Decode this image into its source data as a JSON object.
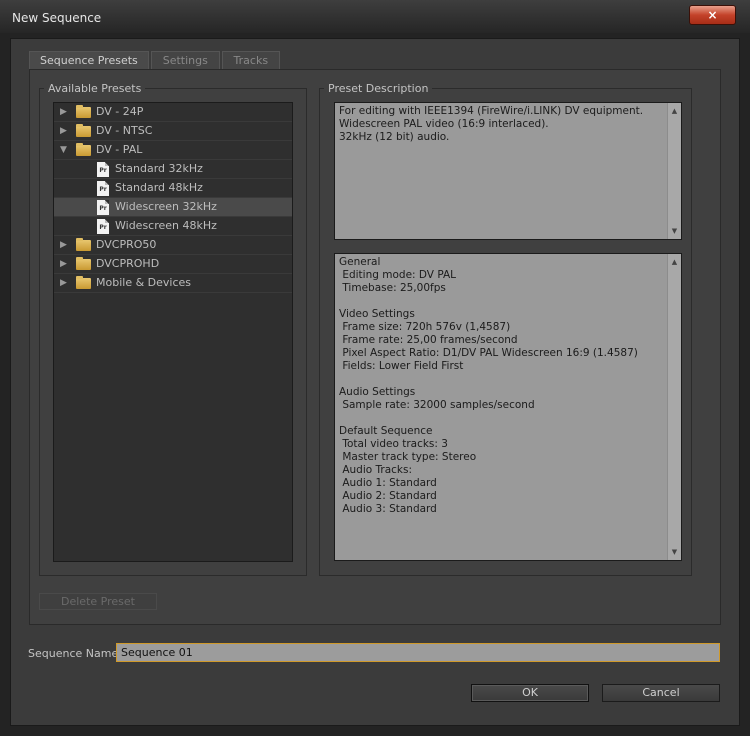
{
  "window": {
    "title": "New Sequence",
    "close_icon": "×"
  },
  "tabs": [
    {
      "label": "Sequence Presets",
      "active": true
    },
    {
      "label": "Settings",
      "active": false
    },
    {
      "label": "Tracks",
      "active": false
    }
  ],
  "presets": {
    "group_label": "Available Presets",
    "items": [
      {
        "type": "folder",
        "label": "DV - 24P",
        "expanded": false
      },
      {
        "type": "folder",
        "label": "DV - NTSC",
        "expanded": false
      },
      {
        "type": "folder",
        "label": "DV - PAL",
        "expanded": true
      },
      {
        "type": "preset",
        "label": "Standard 32kHz"
      },
      {
        "type": "preset",
        "label": "Standard 48kHz"
      },
      {
        "type": "preset",
        "label": "Widescreen 32kHz",
        "selected": true
      },
      {
        "type": "preset",
        "label": "Widescreen 48kHz"
      },
      {
        "type": "folder",
        "label": "DVCPRO50",
        "expanded": false
      },
      {
        "type": "folder",
        "label": "DVCPROHD",
        "expanded": false
      },
      {
        "type": "folder",
        "label": "Mobile & Devices",
        "expanded": false
      }
    ],
    "preset_file_glyph": "Pr"
  },
  "description": {
    "group_label": "Preset Description",
    "summary": "For editing with IEEE1394 (FireWire/i.LINK) DV equipment.\nWidescreen PAL video (16:9 interlaced).\n32kHz (12 bit) audio.",
    "details": "General\n Editing mode: DV PAL\n Timebase: 25,00fps\n\nVideo Settings\n Frame size: 720h 576v (1,4587)\n Frame rate: 25,00 frames/second\n Pixel Aspect Ratio: D1/DV PAL Widescreen 16:9 (1.4587)\n Fields: Lower Field First\n\nAudio Settings\n Sample rate: 32000 samples/second\n\nDefault Sequence\n Total video tracks: 3\n Master track type: Stereo\n Audio Tracks:\n Audio 1: Standard\n Audio 2: Standard\n Audio 3: Standard"
  },
  "delete_preset_label": "Delete Preset",
  "sequence_name": {
    "label": "Sequence Name:",
    "value": "Sequence 01"
  },
  "buttons": {
    "ok": "OK",
    "cancel": "Cancel"
  },
  "colors": {
    "selection": "#4a4a4a",
    "focus_border": "#d09a2a",
    "close_red": "#c4422a"
  }
}
